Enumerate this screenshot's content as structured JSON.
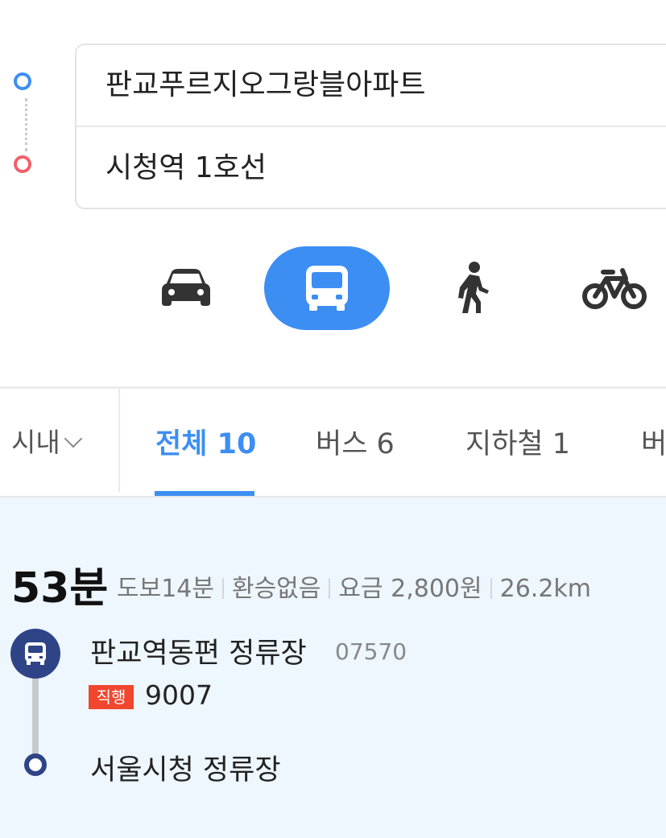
{
  "route": {
    "origin": "판교푸르지오그랑블아파트",
    "destination": "시청역 1호선"
  },
  "modes": [
    {
      "icon": "car-icon",
      "active": false
    },
    {
      "icon": "bus-icon",
      "active": true
    },
    {
      "icon": "walk-icon",
      "active": false
    },
    {
      "icon": "bicycle-icon",
      "active": false
    }
  ],
  "tabs": {
    "region": "시내",
    "items": [
      "전체 10",
      "버스 6",
      "지하철 1",
      "버"
    ],
    "active_index": 0
  },
  "result": {
    "duration": "53분",
    "walk": "도보14분",
    "transfer": "환승없음",
    "fare": "요금 2,800원",
    "distance": "26.2km",
    "board_stop": "판교역동편 정류장",
    "board_stop_id": "07570",
    "bus_badge": "직행",
    "bus_number": "9007",
    "alight_stop": "서울시청 정류장"
  },
  "colors": {
    "accent": "#3c8ef3",
    "start_dot": "#3c8ef3",
    "end_dot": "#f0606a",
    "bus_node": "#2f4486",
    "express_badge": "#f0472e",
    "result_bg": "#eef6fe"
  }
}
